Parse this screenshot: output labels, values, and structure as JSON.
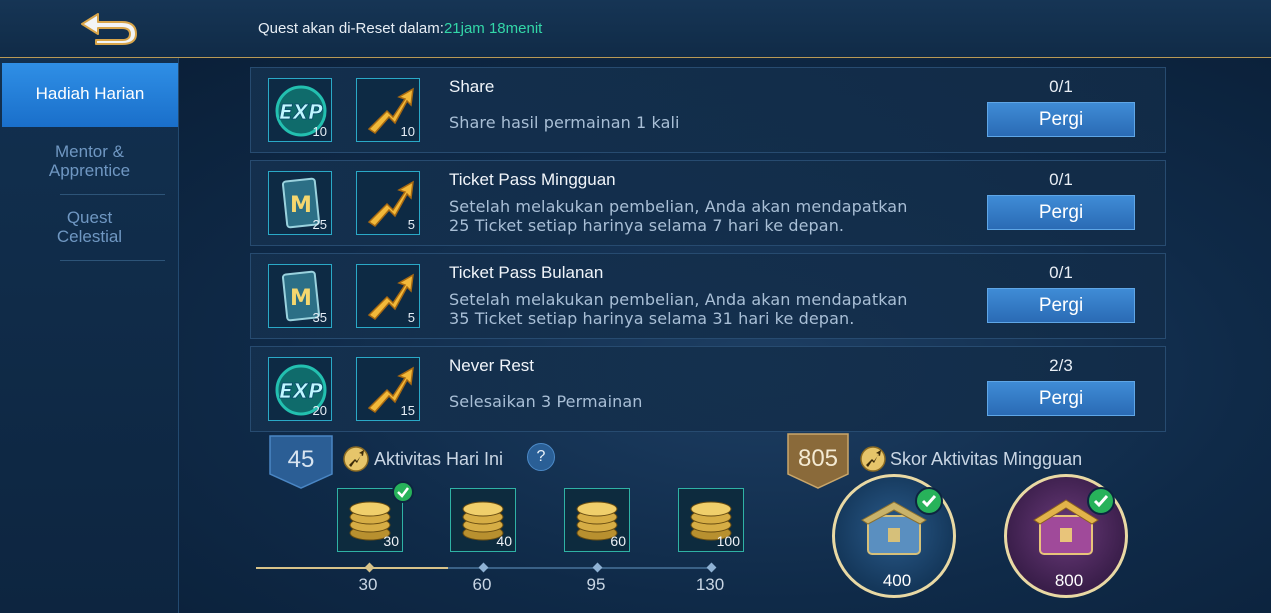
{
  "header": {
    "reset_label": "Quest akan di-Reset dalam:",
    "reset_timer": "21jam 18menit",
    "back_icon": "back-arrow-icon"
  },
  "sidebar": {
    "items": [
      {
        "label": "Hadiah Harian",
        "active": true
      },
      {
        "label": "Mentor &\nApprentice",
        "active": false
      },
      {
        "label": "Quest\nCelestial",
        "active": false
      }
    ]
  },
  "quests": [
    {
      "title": "Share",
      "desc": [
        "Share hasil permainan 1 kali"
      ],
      "progress": "0/1",
      "button": "Pergi",
      "rewards": [
        {
          "icon": "exp-icon",
          "amount": "10"
        },
        {
          "icon": "activity-arrow-icon",
          "amount": "10"
        }
      ]
    },
    {
      "title": "Ticket Pass Mingguan",
      "desc": [
        "Setelah melakukan pembelian, Anda akan mendapatkan",
        "25 Ticket setiap harinya selama 7 hari ke depan."
      ],
      "progress": "0/1",
      "button": "Pergi",
      "rewards": [
        {
          "icon": "ticket-icon",
          "amount": "25"
        },
        {
          "icon": "activity-arrow-icon",
          "amount": "5"
        }
      ]
    },
    {
      "title": "Ticket Pass Bulanan",
      "desc": [
        "Setelah melakukan pembelian, Anda akan mendapatkan",
        "35 Ticket setiap harinya selama 31 hari ke depan."
      ],
      "progress": "0/1",
      "button": "Pergi",
      "rewards": [
        {
          "icon": "ticket-icon",
          "amount": "35"
        },
        {
          "icon": "activity-arrow-icon",
          "amount": "5"
        }
      ]
    },
    {
      "title": "Never Rest",
      "desc": [
        "Selesaikan 3 Permainan"
      ],
      "progress": "2/3",
      "button": "Pergi",
      "rewards": [
        {
          "icon": "exp-icon",
          "amount": "20"
        },
        {
          "icon": "activity-arrow-icon",
          "amount": "15"
        }
      ]
    }
  ],
  "daily_activity": {
    "points": "45",
    "label": "Aktivitas Hari Ini",
    "help": "?",
    "progress_fraction": 0.42,
    "milestones": [
      {
        "threshold": "30",
        "reward": "30",
        "claimed": true
      },
      {
        "threshold": "60",
        "reward": "40",
        "claimed": false
      },
      {
        "threshold": "95",
        "reward": "60",
        "claimed": false
      },
      {
        "threshold": "130",
        "reward": "100",
        "claimed": false
      }
    ]
  },
  "weekly_activity": {
    "points": "805",
    "label": "Skor Aktivitas Mingguan",
    "chests": [
      {
        "threshold": "400",
        "claimed": true
      },
      {
        "threshold": "800",
        "claimed": true
      }
    ]
  },
  "colors": {
    "accent_blue": "#2f8fe6",
    "timer_green": "#33d7a8",
    "gold": "#b89a55",
    "check_green": "#27b25a"
  }
}
